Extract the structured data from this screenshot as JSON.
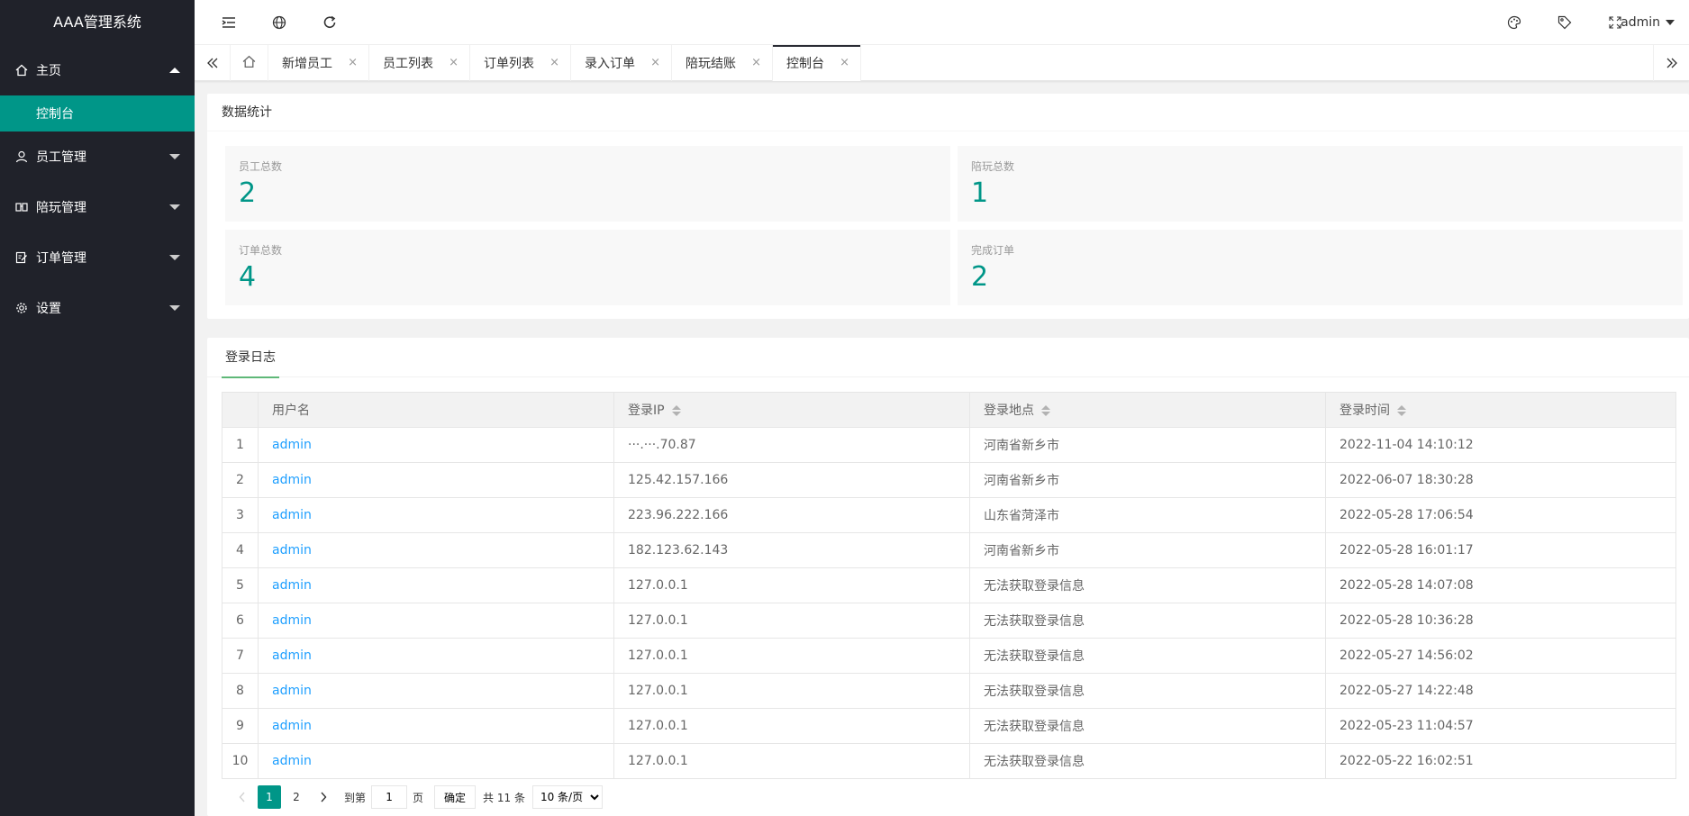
{
  "app": {
    "title": "AAA管理系统"
  },
  "colors": {
    "accent": "#009688",
    "sidebar_bg": "#20222a",
    "link": "#1e9fff"
  },
  "sidebar": {
    "items": [
      {
        "label": "主页",
        "icon": "home-icon",
        "expanded": true,
        "children": [
          {
            "label": "控制台",
            "active": true
          }
        ]
      },
      {
        "label": "员工管理",
        "icon": "user-icon"
      },
      {
        "label": "陪玩管理",
        "icon": "group-icon"
      },
      {
        "label": "订单管理",
        "icon": "order-edit-icon"
      },
      {
        "label": "设置",
        "icon": "gear-icon"
      }
    ]
  },
  "header": {
    "icons_left": [
      "menu-shrink-icon",
      "globe-icon",
      "refresh-icon"
    ],
    "icons_right": [
      "theme-palette-icon",
      "tag-icon",
      "fullscreen-icon"
    ],
    "user": "admin"
  },
  "tabs": {
    "items": [
      {
        "label": "新增员工"
      },
      {
        "label": "员工列表"
      },
      {
        "label": "订单列表"
      },
      {
        "label": "录入订单"
      },
      {
        "label": "陪玩结账"
      },
      {
        "label": "控制台",
        "active": true
      }
    ],
    "close_glyph": "×"
  },
  "stats": {
    "title": "数据统计",
    "items": [
      {
        "label": "员工总数",
        "value": "2"
      },
      {
        "label": "陪玩总数",
        "value": "1"
      },
      {
        "label": "订单总数",
        "value": "4"
      },
      {
        "label": "完成订单",
        "value": "2"
      }
    ]
  },
  "log": {
    "tab": "登录日志",
    "columns": [
      "用户名",
      "登录IP",
      "登录地点",
      "登录时间"
    ],
    "rows": [
      {
        "n": "1",
        "user": "admin",
        "ip": "···.···.70.87",
        "loc": "河南省新乡市",
        "time": "2022-11-04 14:10:12"
      },
      {
        "n": "2",
        "user": "admin",
        "ip": "125.42.157.166",
        "loc": "河南省新乡市",
        "time": "2022-06-07 18:30:28"
      },
      {
        "n": "3",
        "user": "admin",
        "ip": "223.96.222.166",
        "loc": "山东省菏泽市",
        "time": "2022-05-28 17:06:54"
      },
      {
        "n": "4",
        "user": "admin",
        "ip": "182.123.62.143",
        "loc": "河南省新乡市",
        "time": "2022-05-28 16:01:17"
      },
      {
        "n": "5",
        "user": "admin",
        "ip": "127.0.0.1",
        "loc": "无法获取登录信息",
        "time": "2022-05-28 14:07:08"
      },
      {
        "n": "6",
        "user": "admin",
        "ip": "127.0.0.1",
        "loc": "无法获取登录信息",
        "time": "2022-05-28 10:36:28"
      },
      {
        "n": "7",
        "user": "admin",
        "ip": "127.0.0.1",
        "loc": "无法获取登录信息",
        "time": "2022-05-27 14:56:02"
      },
      {
        "n": "8",
        "user": "admin",
        "ip": "127.0.0.1",
        "loc": "无法获取登录信息",
        "time": "2022-05-27 14:22:48"
      },
      {
        "n": "9",
        "user": "admin",
        "ip": "127.0.0.1",
        "loc": "无法获取登录信息",
        "time": "2022-05-23 11:04:57"
      },
      {
        "n": "10",
        "user": "admin",
        "ip": "127.0.0.1",
        "loc": "无法获取登录信息",
        "time": "2022-05-22 16:02:51"
      }
    ]
  },
  "pager": {
    "pages": [
      "1",
      "2"
    ],
    "current": "1",
    "goto_label": "到第",
    "goto_value": "1",
    "page_unit": "页",
    "confirm": "确定",
    "total": "共 11 条",
    "per_page": "10 条/页"
  }
}
